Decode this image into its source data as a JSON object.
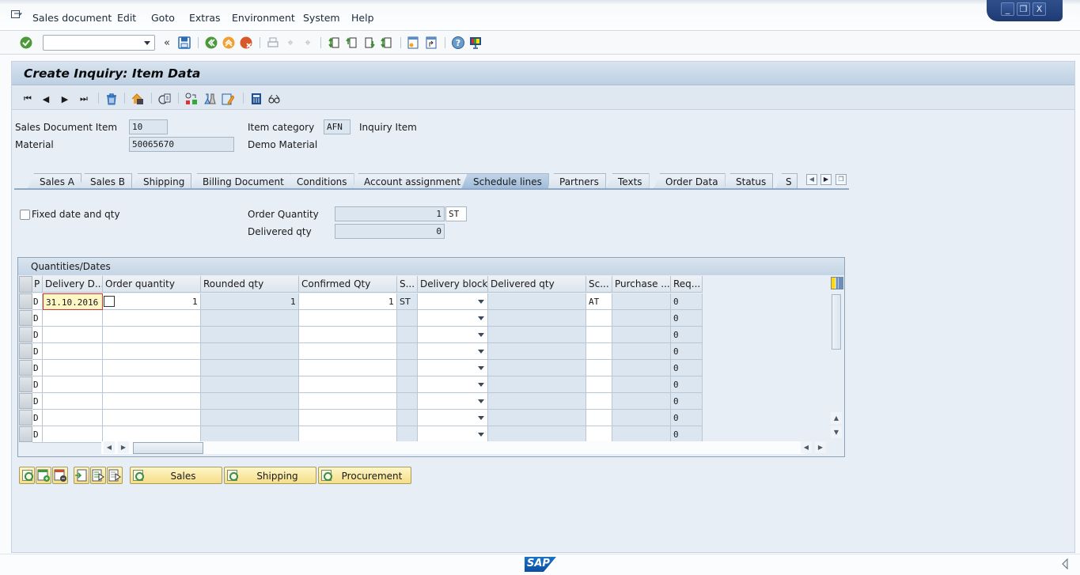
{
  "menubar": {
    "items": [
      "Sales document",
      "Edit",
      "Goto",
      "Extras",
      "Environment",
      "System",
      "Help"
    ],
    "window_controls": [
      "minimize",
      "restore",
      "close"
    ]
  },
  "standard_toolbar": {
    "command_field": {
      "value": "",
      "placeholder": ""
    },
    "icons": [
      "enter-icon",
      "command-field",
      "collapse-icon",
      "save-icon",
      "back-icon",
      "exit-icon",
      "cancel-icon",
      "print-icon",
      "find-icon",
      "find-next-icon",
      "first-page-icon",
      "previous-page-icon",
      "next-page-icon",
      "last-page-icon",
      "create-session-icon",
      "shortcut-icon",
      "help-icon",
      "customize-layout-icon"
    ]
  },
  "header": {
    "title": "Create Inquiry: Item Data"
  },
  "app_toolbar": {
    "icons": [
      "first-item-icon",
      "previous-item-icon",
      "next-item-icon",
      "last-item-icon",
      "delete-icon",
      "header-icon",
      "document-flow-icon",
      "status-icon",
      "configuration-icon",
      "edit-icon",
      "calculator-icon",
      "display-icon"
    ]
  },
  "item_header": {
    "sales_document_item_label": "Sales Document Item",
    "sales_document_item_value": "10",
    "item_category_label": "Item category",
    "item_category_value": "AFN",
    "item_category_text": "Inquiry Item",
    "material_label": "Material",
    "material_value": "50065670",
    "material_text": "Demo Material"
  },
  "tabs": [
    {
      "label": "Sales A",
      "active": false
    },
    {
      "label": "Sales B",
      "active": false
    },
    {
      "label": "Shipping",
      "active": false
    },
    {
      "label": "Billing Document",
      "active": false
    },
    {
      "label": "Conditions",
      "active": false
    },
    {
      "label": "Account assignment",
      "active": false
    },
    {
      "label": "Schedule lines",
      "active": true
    },
    {
      "label": "Partners",
      "active": false
    },
    {
      "label": "Texts",
      "active": false
    },
    {
      "label": "Order Data",
      "active": false
    },
    {
      "label": "Status",
      "active": false
    },
    {
      "label": "S",
      "active": false
    }
  ],
  "schedule_lines": {
    "fixed_date_label": "Fixed date and qty",
    "fixed_date_checked": false,
    "order_quantity_label": "Order Quantity",
    "order_quantity_value": "1",
    "order_quantity_unit": "ST",
    "delivered_qty_label": "Delivered qty",
    "delivered_qty_value": "0"
  },
  "table": {
    "caption": "Quantities/Dates",
    "columns": [
      "P",
      "Delivery D...",
      "Order quantity",
      "Rounded qty",
      "Confirmed Qty",
      "S...",
      "Delivery block",
      "Delivered qty",
      "Sc...",
      "Purchase ...",
      "Req..."
    ],
    "rows": [
      [
        "D",
        "31.10.2016",
        "1",
        "1",
        "1",
        "ST",
        "",
        "",
        "AT",
        "",
        "0"
      ],
      [
        "D",
        "",
        "",
        "",
        "",
        "",
        "",
        "",
        "",
        "",
        "0"
      ],
      [
        "D",
        "",
        "",
        "",
        "",
        "",
        "",
        "",
        "",
        "",
        "0"
      ],
      [
        "D",
        "",
        "",
        "",
        "",
        "",
        "",
        "",
        "",
        "",
        "0"
      ],
      [
        "D",
        "",
        "",
        "",
        "",
        "",
        "",
        "",
        "",
        "",
        "0"
      ],
      [
        "D",
        "",
        "",
        "",
        "",
        "",
        "",
        "",
        "",
        "",
        "0"
      ],
      [
        "D",
        "",
        "",
        "",
        "",
        "",
        "",
        "",
        "",
        "",
        "0"
      ],
      [
        "D",
        "",
        "",
        "",
        "",
        "",
        "",
        "",
        "",
        "",
        "0"
      ],
      [
        "D",
        "",
        "",
        "",
        "",
        "",
        "",
        "",
        "",
        "",
        "0"
      ]
    ]
  },
  "bottom_buttons": {
    "sales": "Sales",
    "shipping": "Shipping",
    "procurement": "Procurement"
  },
  "statusbar": {
    "logo": "SAP"
  }
}
